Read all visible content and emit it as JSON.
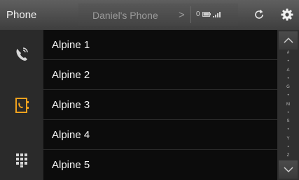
{
  "header": {
    "title": "Phone",
    "device_name": "Daniel's Phone",
    "device_chevron": ">",
    "battery_level": "0"
  },
  "icons": {
    "call_log": "phone-history-icon",
    "contacts": "contacts-book-icon",
    "keypad": "dialpad-icon",
    "refresh": "refresh-icon",
    "settings": "gear-icon",
    "signal": "signal-bars-icon",
    "battery": "battery-icon",
    "scroll_up": "chevron-up-icon",
    "scroll_down": "chevron-down-icon"
  },
  "colors": {
    "accent": "#f0a21e",
    "topbar": "#4f4f4f",
    "sidebar": "#2a2a2a",
    "list_bg": "#0c0c0c"
  },
  "contacts": [
    {
      "name": "Alpine 1"
    },
    {
      "name": "Alpine 2"
    },
    {
      "name": "Alpine 3"
    },
    {
      "name": "Alpine 4"
    },
    {
      "name": "Alpine 5"
    }
  ],
  "index_labels": [
    "#",
    "•",
    "A",
    "•",
    "G",
    "•",
    "M",
    "•",
    "S",
    "•",
    "Y",
    "•",
    "Z"
  ],
  "sidebar": {
    "selected": "contacts"
  }
}
